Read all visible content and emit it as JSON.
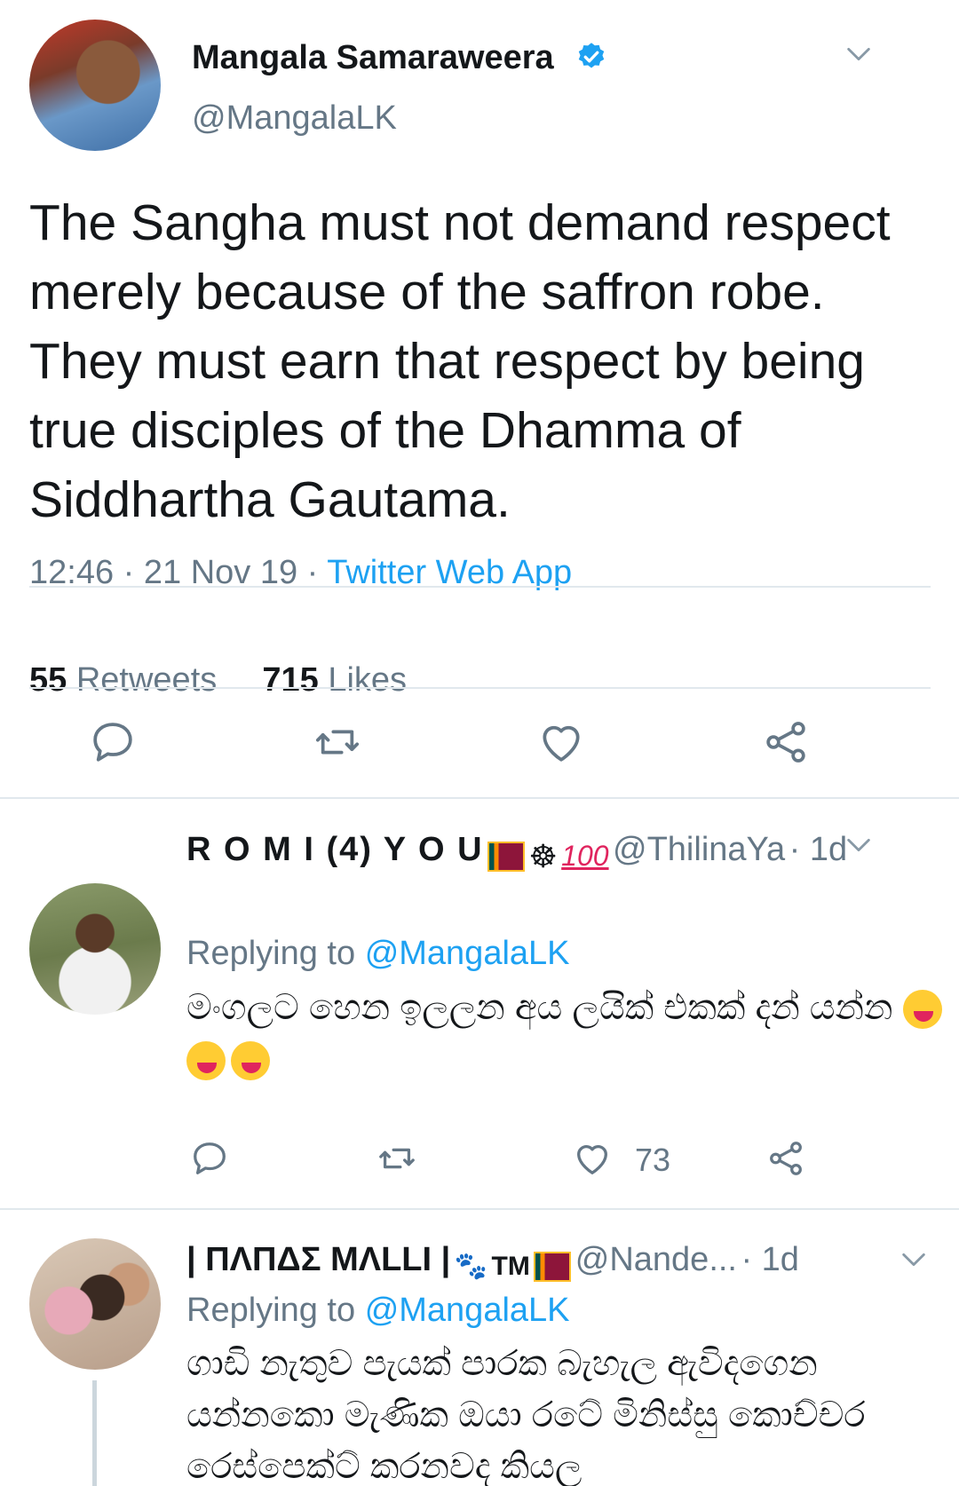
{
  "main_tweet": {
    "author_name": "Mangala Samaraweera",
    "handle": "@MangalaLK",
    "text": "The Sangha must not demand respect merely because of the saffron robe. They must earn that respect by being true disciples of the Dhamma of Siddhartha Gautama.",
    "time": "12:46",
    "date": "21 Nov 19",
    "source": "Twitter Web App",
    "retweet_count": "55",
    "retweet_label": "Retweets",
    "like_count": "715",
    "like_label": "Likes",
    "verified_color": "#1da1f2"
  },
  "replies": [
    {
      "author_name": "R O M I (4) Y O U",
      "handle": "@ThilinaYa",
      "age": "· 1d",
      "replying_label": "Replying to",
      "replying_to": "@MangalaLK",
      "text": "මංගලට හෙන ඉලලන අය ලයික් එකක් දන් යන්න",
      "like_count": "73"
    },
    {
      "author_name": "| ΠΛΠΔΣ MΛLLI |",
      "handle": "@Nande...",
      "age": "· 1d",
      "replying_label": "Replying to",
      "replying_to": "@MangalaLK",
      "text": "ගාඩි නැතුව පැයක් පාරක බැහැල ඇවිදගෙන යන්නකො මැණික ඔයා රටේ මිනිස්සු කොච්චර රෙස්පෙක්ට් කරනවද කියල"
    }
  ],
  "icons": {
    "reply": "reply-icon",
    "retweet": "retweet-icon",
    "like": "heart-icon",
    "share": "share-icon",
    "more": "chevron-down-icon",
    "verified": "verified-badge-icon"
  }
}
